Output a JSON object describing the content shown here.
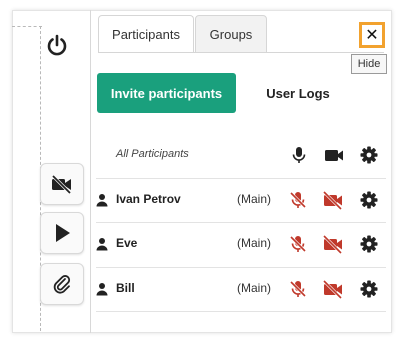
{
  "tabs": {
    "participants": "Participants",
    "groups": "Groups"
  },
  "close_symbol": "✕",
  "tooltip": "Hide",
  "actions": {
    "invite": "Invite participants",
    "user_logs": "User Logs"
  },
  "header": {
    "all_participants": "All Participants"
  },
  "participants": [
    {
      "name": "Ivan Petrov",
      "role": "(Main)"
    },
    {
      "name": "Eve",
      "role": "(Main)"
    },
    {
      "name": "Bill",
      "role": "(Main)"
    }
  ],
  "icons": {
    "power": "power-icon",
    "video_off": "video-off-icon",
    "play": "play-icon",
    "attach": "paperclip-icon",
    "mic": "microphone-icon",
    "mic_muted": "microphone-muted-icon",
    "cam": "video-camera-icon",
    "cam_off": "video-camera-off-icon",
    "gear": "gear-icon",
    "user": "user-icon"
  },
  "colors": {
    "accent": "#1aa07d",
    "muted": "#c0392b",
    "highlight": "#f2a22e"
  }
}
